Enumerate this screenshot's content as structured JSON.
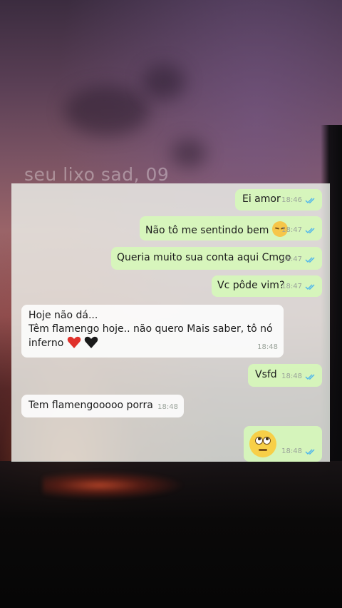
{
  "watermark": "seu lixo sad, 09",
  "colors": {
    "outgoing_bubble": "#d6f7ba",
    "incoming_bubble": "#fcfcfc",
    "read_check": "#4fb6ec",
    "time_text": "#9aa39a"
  },
  "messages": [
    {
      "direction": "out",
      "text": "Ei amor",
      "time": "18:46",
      "status": "read"
    },
    {
      "direction": "out",
      "text": "Não tô me sentindo bem",
      "emoji": "pensive-face",
      "time": "18:47",
      "status": "read"
    },
    {
      "direction": "out",
      "text": "Queria muito sua conta aqui Cmgo",
      "time": "18:47",
      "status": "read"
    },
    {
      "direction": "out",
      "text": "Vc pôde vim?",
      "time": "18:47",
      "status": "read"
    },
    {
      "direction": "in",
      "lines": [
        "Hoje não dá...",
        "Têm flamengo hoje.. não quero Mais saber, tô nó",
        "inferno"
      ],
      "emoji": [
        "red-heart",
        "black-heart"
      ],
      "time": "18:48"
    },
    {
      "direction": "out",
      "text": "Vsfd",
      "time": "18:48",
      "status": "read"
    },
    {
      "direction": "in",
      "text": "Tem flamengooooo porra",
      "time": "18:48"
    },
    {
      "direction": "out",
      "emoji": "face-with-rolling-eyes",
      "time": "18:48",
      "status": "read"
    }
  ]
}
